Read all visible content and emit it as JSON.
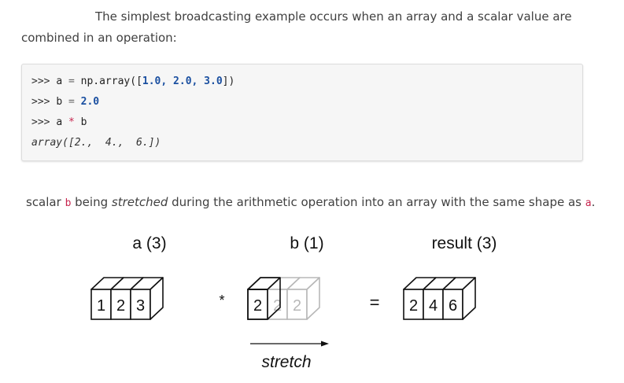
{
  "intro": {
    "text": "The simplest broadcasting example occurs when an array and a scalar value are combined in an operation:"
  },
  "code": {
    "lines": [
      {
        "prompt": ">>> ",
        "lhs": "a",
        "eq": " = ",
        "rhs_pre": "np.array([",
        "rhs_nums": "1.0, 2.0, 3.0",
        "rhs_post": "])"
      },
      {
        "prompt": ">>> ",
        "lhs": "b",
        "eq": " = ",
        "rhs_num": "2.0"
      },
      {
        "prompt": ">>> ",
        "lhs": "a",
        "op": " * ",
        "rhs": "b"
      }
    ],
    "output": "array([2.,  4.,  6.])"
  },
  "caption": {
    "p1": "scalar ",
    "code_b": "b",
    "p2": " being ",
    "em": "stretched",
    "p3": " during the arithmetic operation into an array with the same shape as ",
    "code_a": "a",
    "p4": "."
  },
  "figure": {
    "label_a": "a (3)",
    "label_b": "b (1)",
    "label_result": "result (3)",
    "a_values": [
      "1",
      "2",
      "3"
    ],
    "b_values": [
      "2",
      "2",
      "2"
    ],
    "result_values": [
      "2",
      "4",
      "6"
    ],
    "times": "*",
    "equals": "=",
    "stretch_label": "stretch"
  },
  "colors": {
    "code_bg": "#f6f6f6",
    "inline_code": "#c7254e",
    "faded": "#b8b8b8"
  }
}
